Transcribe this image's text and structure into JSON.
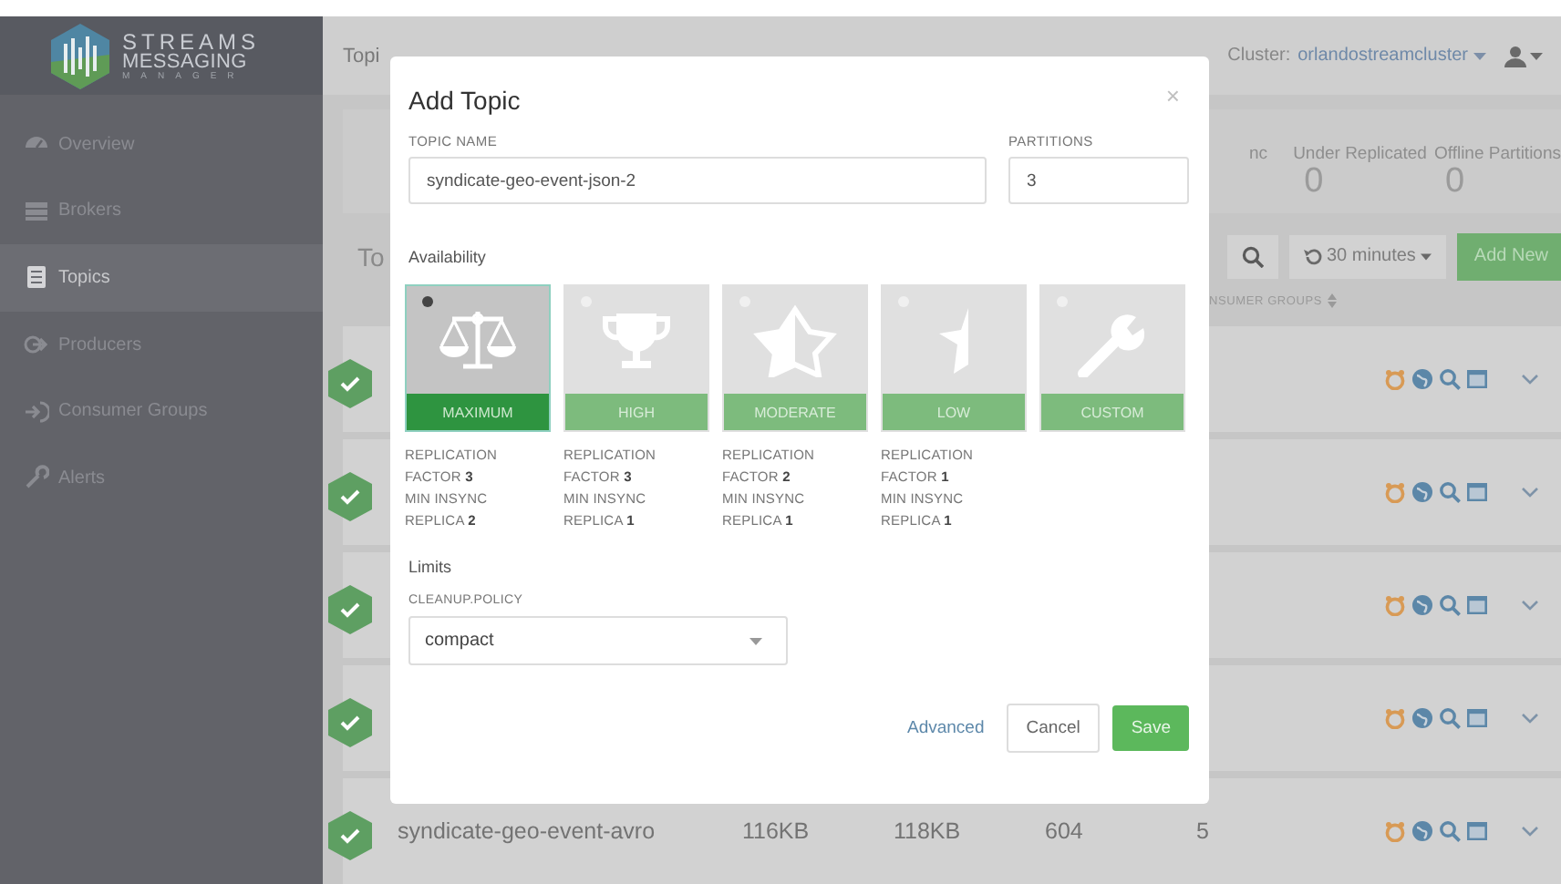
{
  "logo": {
    "lines": [
      "STREAMS",
      "MESSAGING",
      "MANAGER"
    ]
  },
  "sidebar": {
    "items": [
      {
        "label": "Overview",
        "selected": false
      },
      {
        "label": "Brokers",
        "selected": false
      },
      {
        "label": "Topics",
        "selected": true
      },
      {
        "label": "Producers",
        "selected": false
      },
      {
        "label": "Consumer Groups",
        "selected": false
      },
      {
        "label": "Alerts",
        "selected": false
      }
    ]
  },
  "header": {
    "breadcrumb": "Topi",
    "cluster_label": "Cluster:",
    "cluster": "orlandostreamcluster"
  },
  "stats": [
    {
      "label": "nc"
    },
    {
      "label": "Under Replicated",
      "value": "0"
    },
    {
      "label": "Offline Partitions",
      "value": "0"
    }
  ],
  "toolbar": {
    "title": "To",
    "time_range": "30 minutes",
    "add_button": "Add New"
  },
  "table": {
    "columns": [
      "NSUMER GROUPS"
    ],
    "rows": [
      {},
      {},
      {},
      {},
      {
        "cells": [
          "syndicate-geo-event-avro",
          "116KB",
          "118KB",
          "604",
          "5"
        ]
      }
    ]
  },
  "dialog": {
    "title": "Add Topic",
    "close": "×",
    "topic_name": {
      "label": "TOPIC NAME",
      "value": "syndicate-geo-event-json-2"
    },
    "partitions": {
      "label": "PARTITIONS",
      "value": "3"
    },
    "availability": {
      "heading": "Availability",
      "options": [
        {
          "label": "MAXIMUM",
          "selected": true,
          "details": [
            "REPLICATION",
            "FACTOR **3**",
            "MIN INSYNC",
            "REPLICA **2**"
          ]
        },
        {
          "label": "HIGH",
          "selected": false,
          "details": [
            "REPLICATION",
            "FACTOR **3**",
            "MIN INSYNC",
            "REPLICA **1**"
          ]
        },
        {
          "label": "MODERATE",
          "selected": false,
          "details": [
            "REPLICATION",
            "FACTOR **2**",
            "MIN INSYNC",
            "REPLICA **1**"
          ]
        },
        {
          "label": "LOW",
          "selected": false,
          "details": [
            "REPLICATION",
            "FACTOR **1**",
            "MIN INSYNC",
            "REPLICA **1**"
          ]
        },
        {
          "label": "CUSTOM",
          "selected": false
        }
      ]
    },
    "limits": {
      "heading": "Limits",
      "cleanup_policy": {
        "label": "CLEANUP.POLICY",
        "value": "compact"
      }
    },
    "buttons": [
      {
        "label": "Advanced",
        "kind": "link"
      },
      {
        "label": "Cancel",
        "kind": "secondary"
      },
      {
        "label": "Save",
        "kind": "primary"
      }
    ]
  }
}
